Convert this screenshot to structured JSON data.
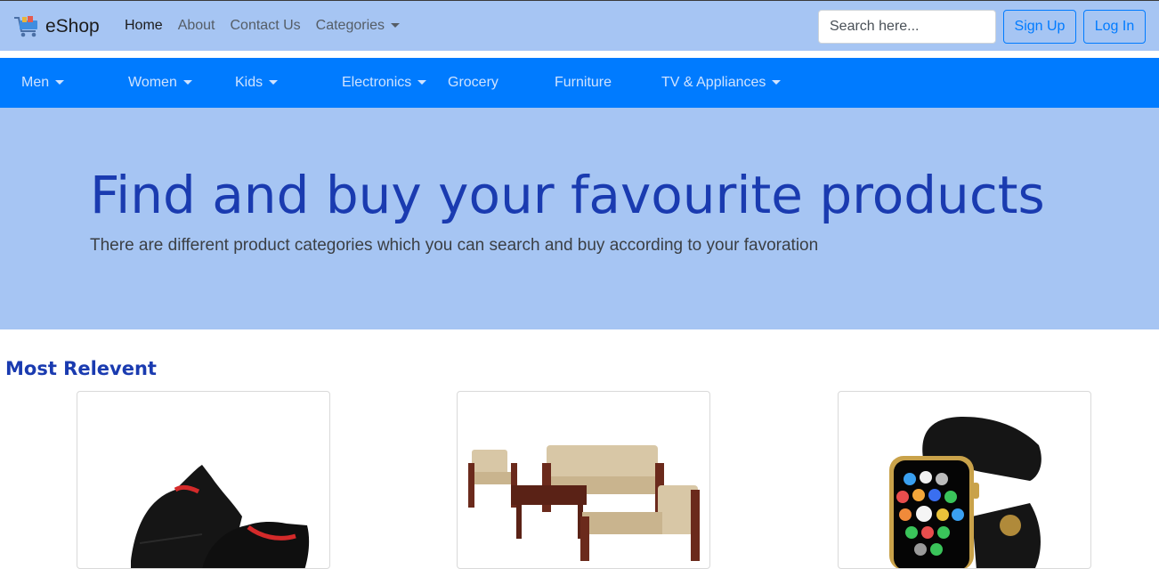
{
  "brand": {
    "name": "eShop",
    "icon": "shopping-cart-icon"
  },
  "topnav": {
    "home": "Home",
    "about": "About",
    "contact": "Contact Us",
    "categories": "Categories"
  },
  "search": {
    "placeholder": "Search here..."
  },
  "auth": {
    "signup": "Sign Up",
    "login": "Log In"
  },
  "categories": {
    "men": "Men",
    "women": "Women",
    "kids": "Kids",
    "electronics": "Electronics",
    "grocery": "Grocery",
    "furniture": "Furniture",
    "tv": "TV & Appliances"
  },
  "hero": {
    "title": "Find and buy your favourite products",
    "subtitle": "There are different product categories which you can search and buy according to your favoration"
  },
  "section": {
    "title": "Most Relevent"
  },
  "products": [
    {
      "image": "black-sneakers-image"
    },
    {
      "image": "wooden-sofa-set-image"
    },
    {
      "image": "smartwatch-image"
    }
  ],
  "colors": {
    "nav_bg": "#a6c5f3",
    "category_bar": "#007bff",
    "hero_title": "#1a3bb0",
    "button": "#007bff"
  }
}
